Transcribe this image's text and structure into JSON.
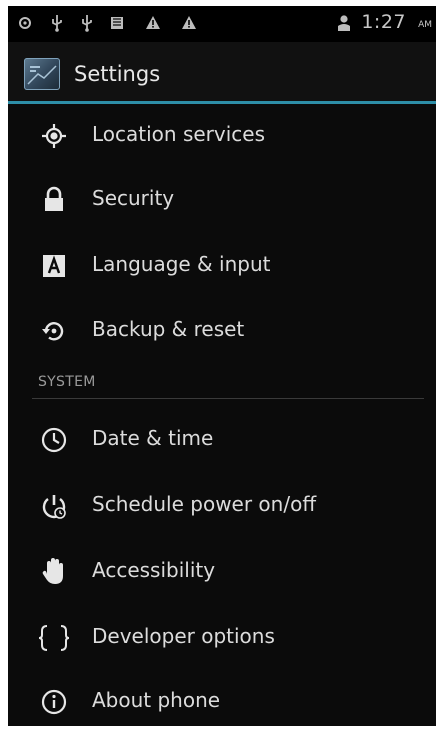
{
  "status_bar": {
    "icons_left": [
      "usb-debug-icon",
      "usb-icon",
      "usb-icon",
      "sd-card-icon",
      "warning-icon",
      "warning-icon"
    ],
    "icons_right": [
      "person-icon"
    ],
    "time": "1:27",
    "ampm": "AM"
  },
  "action_bar": {
    "title": "Settings",
    "app_icon": "settings-app-icon"
  },
  "items_top": [
    {
      "label": "Location services",
      "icon": "location-icon"
    },
    {
      "label": "Security",
      "icon": "lock-icon"
    },
    {
      "label": "Language & input",
      "icon": "keyboard-a-icon"
    },
    {
      "label": "Backup & reset",
      "icon": "backup-restore-icon"
    }
  ],
  "section": {
    "header": "SYSTEM"
  },
  "items_system": [
    {
      "label": "Date & time",
      "icon": "clock-icon"
    },
    {
      "label": "Schedule power on/off",
      "icon": "power-schedule-icon"
    },
    {
      "label": "Accessibility",
      "icon": "hand-icon"
    },
    {
      "label": "Developer options",
      "icon": "braces-icon"
    },
    {
      "label": "About phone",
      "icon": "info-icon"
    }
  ],
  "colors": {
    "background": "#0b0b0b",
    "accent": "#2e8fa8",
    "text": "#dcdcdc",
    "section_text": "#9a9a9a"
  }
}
